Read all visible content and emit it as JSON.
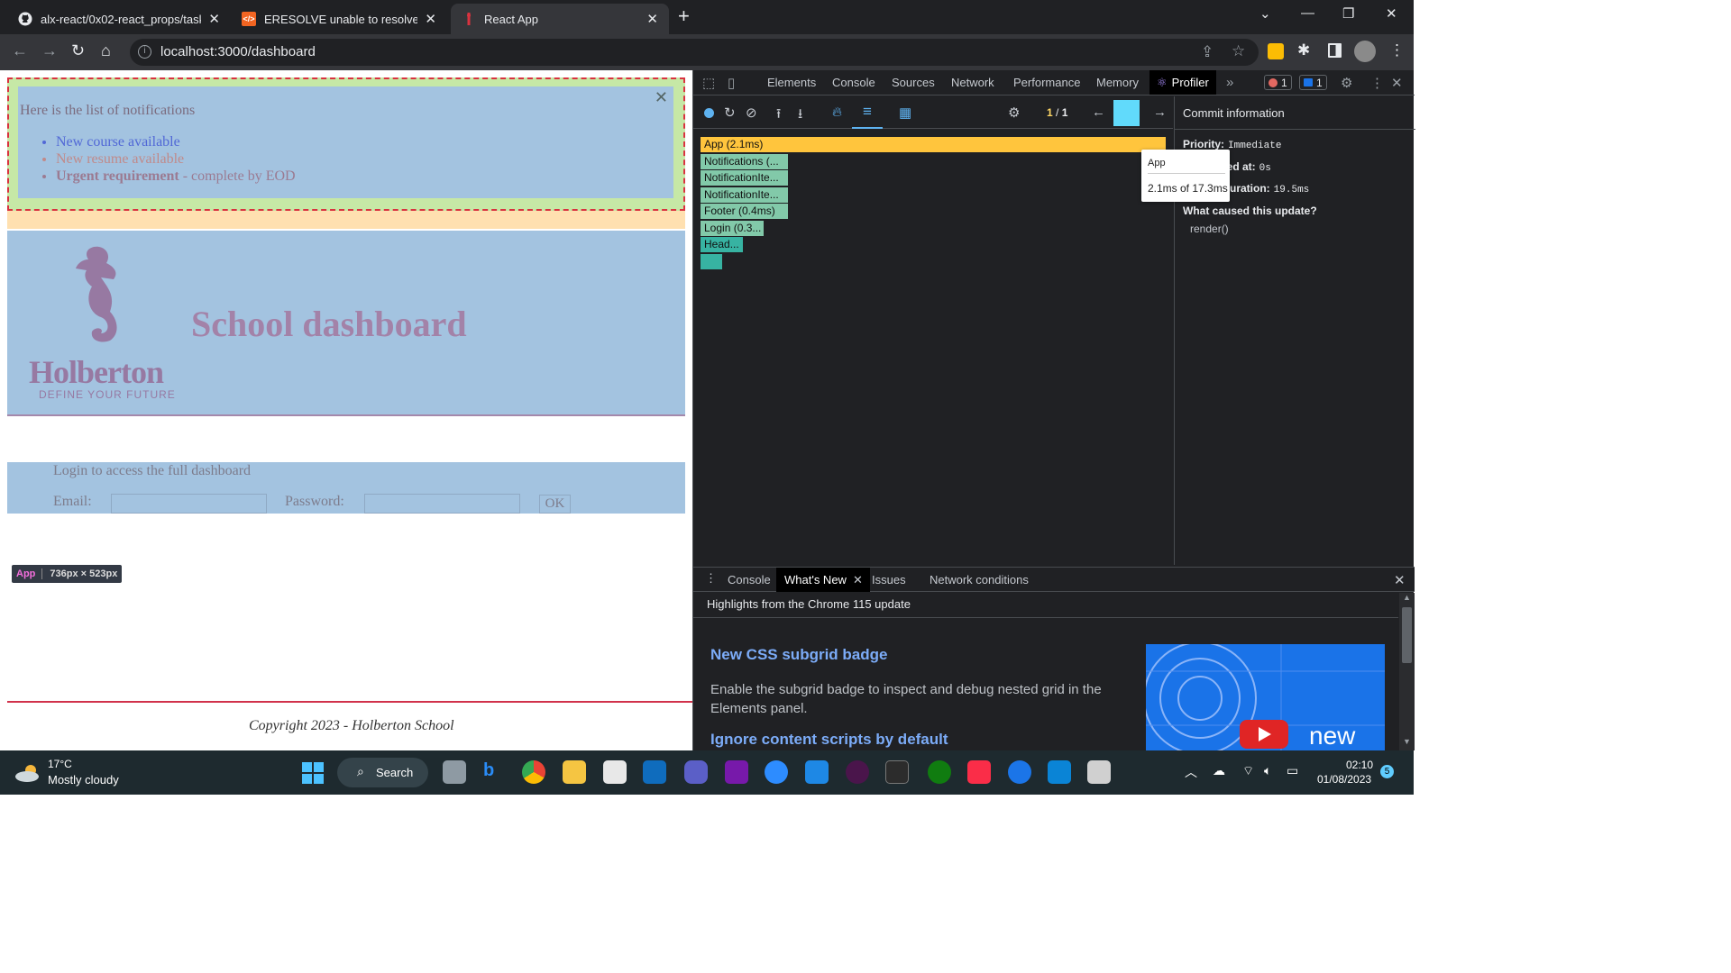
{
  "browser": {
    "tabs": [
      {
        "title": "alx-react/0x02-react_props/task_",
        "icon": "github-icon"
      },
      {
        "title": "ERESOLVE unable to resolve depe",
        "icon": "code-icon"
      },
      {
        "title": "React App",
        "icon": "react-icon"
      }
    ],
    "url": "localhost:3000/dashboard"
  },
  "page": {
    "notifications": {
      "title": "Here is the list of notifications",
      "close": "✕",
      "items": [
        {
          "text": "New course available",
          "type": "default"
        },
        {
          "text": "New resume available",
          "type": "urgent"
        },
        {
          "bold": "Urgent requirement",
          "rest": " - complete by EOD",
          "type": "html"
        }
      ]
    },
    "header": {
      "logo_text": "Holberton",
      "logo_tagline": "DEFINE YOUR FUTURE",
      "title": "School dashboard"
    },
    "login": {
      "message": "Login to access the full dashboard",
      "email_label": "Email:",
      "password_label": "Password:",
      "button": "OK"
    },
    "inspect_badge": {
      "component": "App",
      "size": "736px × 523px"
    },
    "footer": "Copyright 2023 - Holberton School"
  },
  "devtools": {
    "tabs": [
      "Elements",
      "Console",
      "Sources",
      "Network",
      "Performance",
      "Memory",
      "Profiler"
    ],
    "active_tab": "Profiler",
    "error_count": "1",
    "message_count": "1",
    "commit_index": "1",
    "commit_sep": "/",
    "commit_total": "1",
    "flamegraph": [
      {
        "label": "App (2.1ms)",
        "kind": "app"
      },
      {
        "label": "Notifications (...",
        "kind": "g"
      },
      {
        "label": "NotificationIte...",
        "kind": "g"
      },
      {
        "label": "NotificationIte...",
        "kind": "g"
      },
      {
        "label": "Footer (0.4ms)",
        "kind": "g"
      },
      {
        "label": "Login (0.3...",
        "kind": "g"
      },
      {
        "label": "Head...",
        "kind": "t"
      },
      {
        "label": "",
        "kind": "t"
      }
    ],
    "tooltip": {
      "name": "App",
      "time": "2.1ms of 17.3ms"
    },
    "commit_info": {
      "heading": "Commit information",
      "priority_label": "Priority:",
      "priority": "Immediate",
      "committed_label": "Committed at:",
      "committed": "0s",
      "duration_label": "Render duration:",
      "duration": "19.5ms",
      "cause_label": "What caused this update?",
      "cause": "render()"
    },
    "drawer": {
      "tabs": [
        "Console",
        "What's New",
        "Issues",
        "Network conditions"
      ],
      "active": "What's New",
      "subtitle": "Highlights from the Chrome 115 update",
      "h1": "New CSS subgrid badge",
      "p1": "Enable the subgrid badge to inspect and debug nested grid in the Elements panel.",
      "h2": "Ignore content scripts by default",
      "video_label": "new"
    }
  },
  "taskbar": {
    "temperature": "17°C",
    "weather": "Mostly cloudy",
    "search": "Search",
    "time": "02:10",
    "date": "01/08/2023",
    "notifications": "5"
  }
}
